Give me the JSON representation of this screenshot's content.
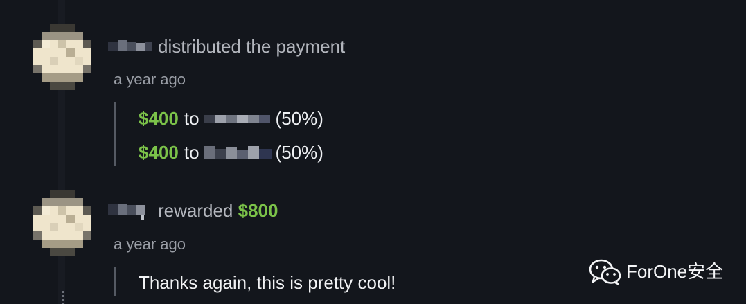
{
  "activity": [
    {
      "action": "distributed the payment",
      "time": "a year ago",
      "payments": [
        {
          "amount": "$400",
          "to": "to",
          "percent": "(50%)"
        },
        {
          "amount": "$400",
          "to": "to",
          "percent": "(50%)"
        }
      ]
    },
    {
      "action": "rewarded",
      "amount": "$800",
      "time": "a year ago",
      "comment": "Thanks again, this is pretty cool!"
    }
  ],
  "watermark": {
    "text": "ForOne安全",
    "icon": "wechat-icon"
  },
  "colors": {
    "background": "#13161c",
    "accent_green": "#7bc249",
    "muted_text": "#b3b6bd",
    "quote_bar": "#555a63"
  }
}
